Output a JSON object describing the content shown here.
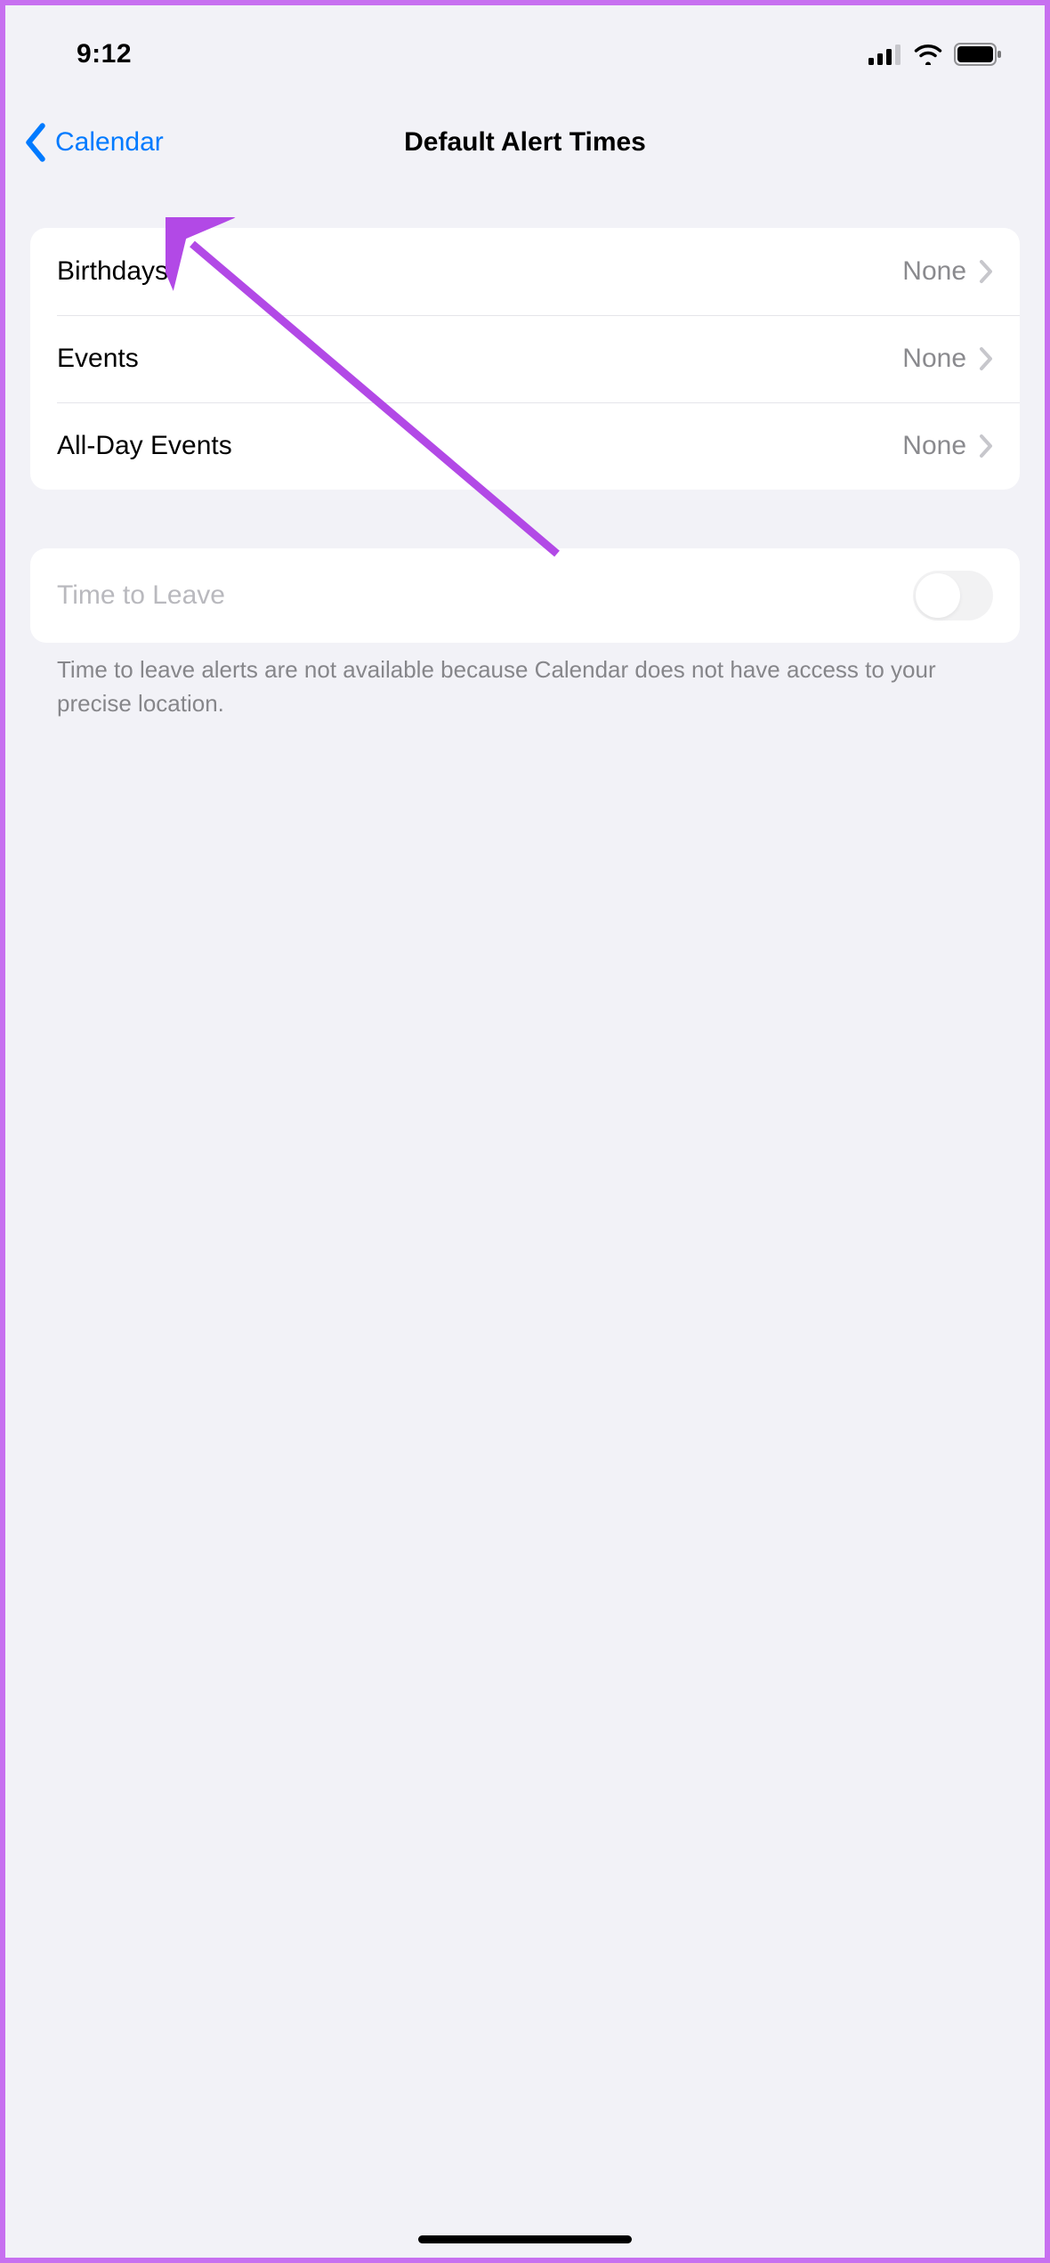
{
  "status": {
    "time": "9:12"
  },
  "nav": {
    "back_label": "Calendar",
    "title": "Default Alert Times"
  },
  "alerts": {
    "rows": [
      {
        "label": "Birthdays",
        "value": "None"
      },
      {
        "label": "Events",
        "value": "None"
      },
      {
        "label": "All-Day Events",
        "value": "None"
      }
    ]
  },
  "time_to_leave": {
    "label": "Time to Leave",
    "enabled": false,
    "footer": "Time to leave alerts are not available because Calendar does not have access to your precise location."
  },
  "annotation": {
    "arrow_color": "#b249e6"
  }
}
